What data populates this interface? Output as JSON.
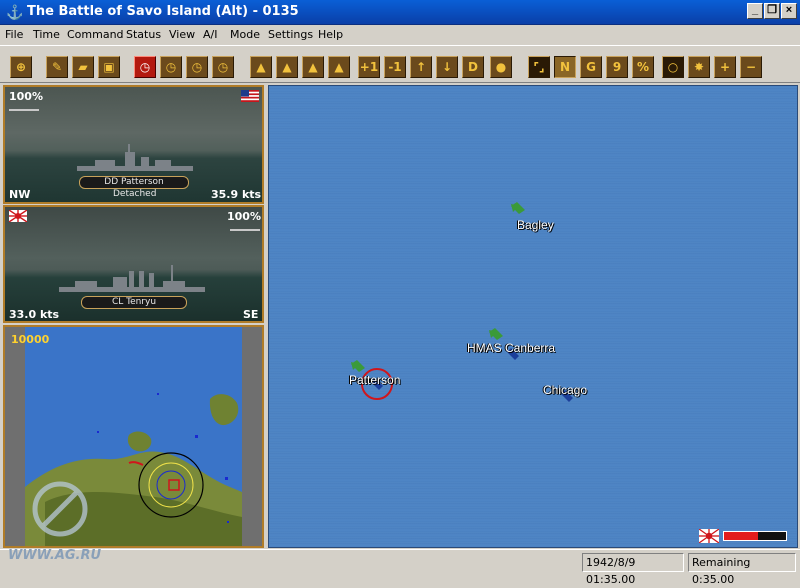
{
  "window": {
    "title": "The Battle of Savo Island (Alt) - 0135",
    "minimize": "_",
    "restore": "❐",
    "close": "×"
  },
  "menu": [
    "File",
    "Time",
    "Command",
    "Status",
    "View",
    "A/I",
    "Mode",
    "Settings",
    "Help"
  ],
  "toolbar": {
    "move_up": "↑",
    "move_down": "↓",
    "plus_one": "+1",
    "minus_one": "-1",
    "d": "D",
    "n": "N",
    "g": "G",
    "nine": "9",
    "percent": "%",
    "plus": "+",
    "minus": "−"
  },
  "friendly_ship": {
    "health": "100%",
    "name": "DD Patterson",
    "status": "Detached",
    "heading": "NW",
    "speed": "35.9 kts",
    "nation": "US"
  },
  "target_ship": {
    "health": "100%",
    "name": "CL Tenryu",
    "heading": "SE",
    "speed": "33.0 kts",
    "nation": "Japan"
  },
  "minimap": {
    "scale": "10000"
  },
  "map": {
    "labels": {
      "bagley": "Bagley",
      "canberra": "HMAS Canberra",
      "patterson": "Patterson",
      "chicago": "Chicago"
    },
    "engagement_level": 0.55
  },
  "status": {
    "datetime": "1942/8/9 01:35.00",
    "remaining": "Remaining 0:35.00"
  },
  "watermark": "WWW.AG.RU",
  "colors": {
    "sea": "#4f86c6",
    "friendly_arrow": "#3b9a3a",
    "enemy_arrow": "#1c3f9a",
    "selection_ring": "#e31b1b",
    "panel_border": "#b07c28"
  }
}
